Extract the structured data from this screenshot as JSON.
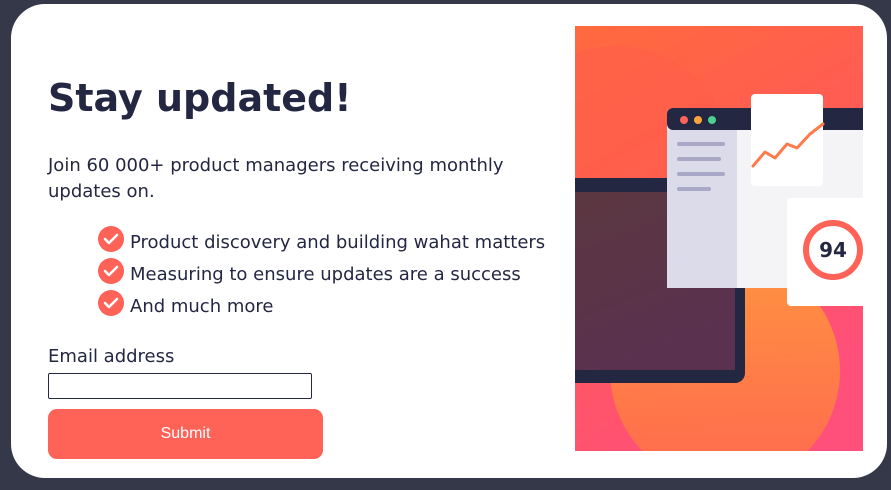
{
  "signup": {
    "title": "Stay updated!",
    "intro": "Join 60 000+ product managers receiving monthly updates on.",
    "benefits": [
      "Product discovery and building wahat matters",
      "Measuring to ensure updates are a success",
      "And much more"
    ],
    "email_label": "Email address",
    "email_value": "",
    "submit_label": "Submit"
  },
  "illustration": {
    "score_text": "94",
    "icon": "dashboard-illustration"
  },
  "colors": {
    "accent": "#ff6257",
    "text": "#242742",
    "background": "#353849",
    "card": "#ffffff"
  }
}
